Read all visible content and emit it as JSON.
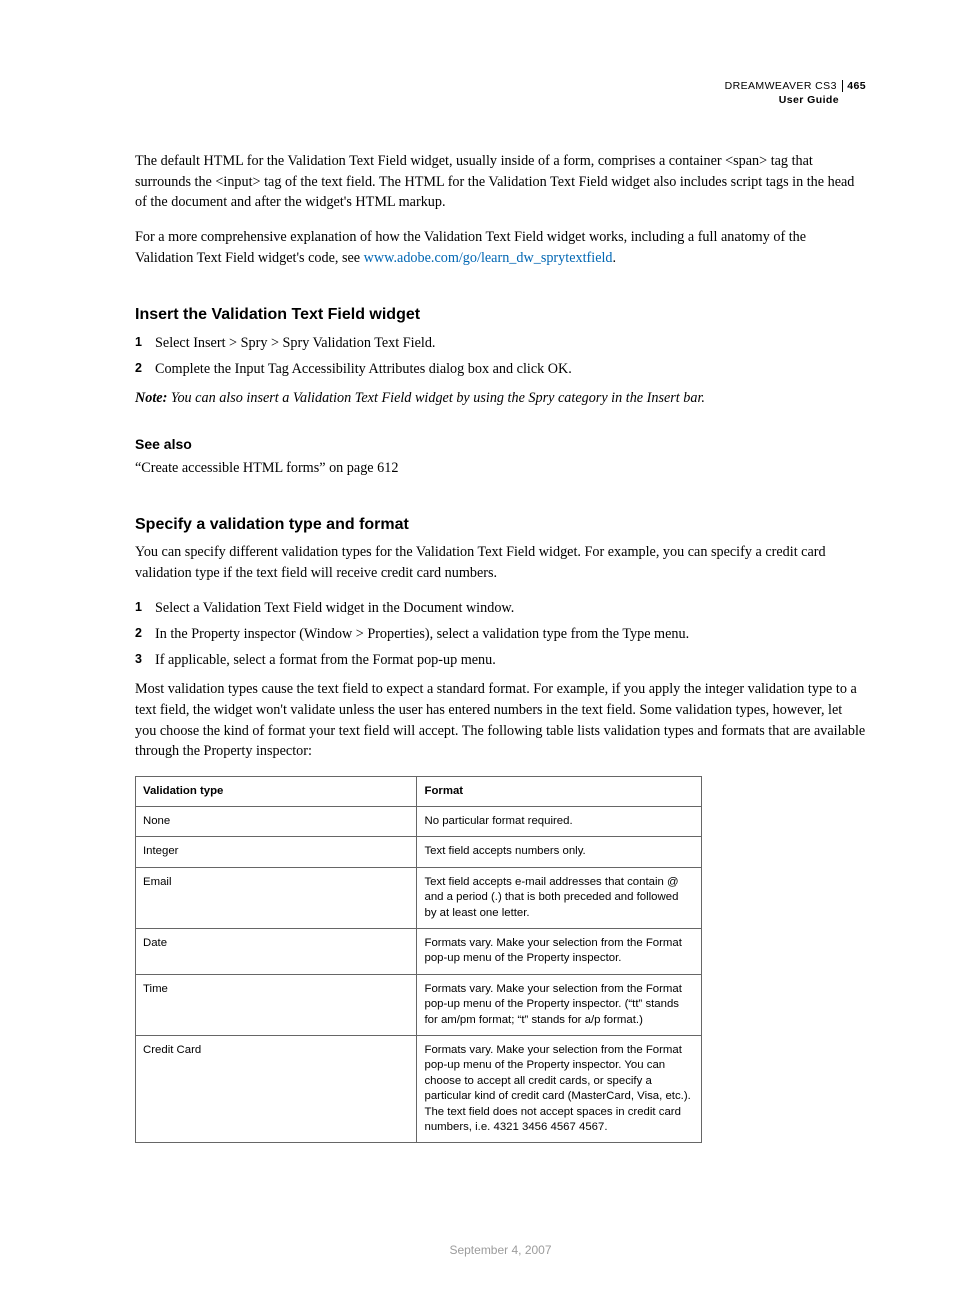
{
  "header": {
    "product": "DREAMWEAVER CS3",
    "pagenum": "465",
    "subtitle": "User Guide"
  },
  "intro": {
    "p1": "The default HTML for the Validation Text Field widget, usually inside of a form, comprises a container <span> tag that surrounds the <input> tag of the text field. The HTML for the Validation Text Field widget also includes script tags in the head of the document and after the widget's HTML markup.",
    "p2a": "For a more comprehensive explanation of how the Validation Text Field widget works, including a full anatomy of the Validation Text Field widget's code, see ",
    "p2link": "www.adobe.com/go/learn_dw_sprytextfield",
    "p2b": "."
  },
  "sec1": {
    "heading": "Insert the Validation Text Field widget",
    "step1": "Select Insert > Spry > Spry Validation Text Field.",
    "step2": "Complete the Input Tag Accessibility Attributes dialog box and click OK.",
    "note_label": "Note:",
    "note_text": " You can also insert a Validation Text Field widget by using the Spry category in the Insert bar."
  },
  "seealso": {
    "heading": "See also",
    "line": "“Create accessible HTML forms” on page 612"
  },
  "sec2": {
    "heading": "Specify a validation type and format",
    "intro": "You can specify different validation types for the Validation Text Field widget. For example, you can specify a credit card validation type if the text field will receive credit card numbers.",
    "step1": "Select a Validation Text Field widget in the Document window.",
    "step2": "In the Property inspector (Window > Properties), select a validation type from the Type menu.",
    "step3": "If applicable, select a format from the Format pop-up menu.",
    "after": "Most validation types cause the text field to expect a standard format. For example, if you apply the integer validation type to a text field, the widget won't validate unless the user has entered numbers in the text field. Some validation types, however, let you choose the kind of format your text field will accept. The following table lists validation types and formats that are available through the Property inspector:"
  },
  "table": {
    "h1": "Validation type",
    "h2": "Format",
    "rows": [
      {
        "type": "None",
        "format": "No particular format required."
      },
      {
        "type": "Integer",
        "format": "Text field accepts numbers only."
      },
      {
        "type": "Email",
        "format": "Text field accepts e-mail addresses that contain @ and a period (.) that is both preceded and followed by at least one letter."
      },
      {
        "type": "Date",
        "format": "Formats vary. Make your selection from the Format pop-up menu of the Property inspector."
      },
      {
        "type": "Time",
        "format": "Formats vary. Make your selection from the Format pop-up menu of the Property inspector. (“tt” stands for am/pm format; “t” stands for a/p format.)"
      },
      {
        "type": "Credit Card",
        "format": "Formats vary. Make your selection from the Format pop-up menu of the Property inspector. You can choose to accept all credit cards, or specify a particular kind of credit card (MasterCard, Visa, etc.). The text field does not accept spaces in credit card numbers, i.e. 4321 3456 4567 4567."
      }
    ]
  },
  "footer": {
    "date": "September 4, 2007"
  },
  "nums": {
    "n1": "1",
    "n2": "2",
    "n3": "3"
  }
}
